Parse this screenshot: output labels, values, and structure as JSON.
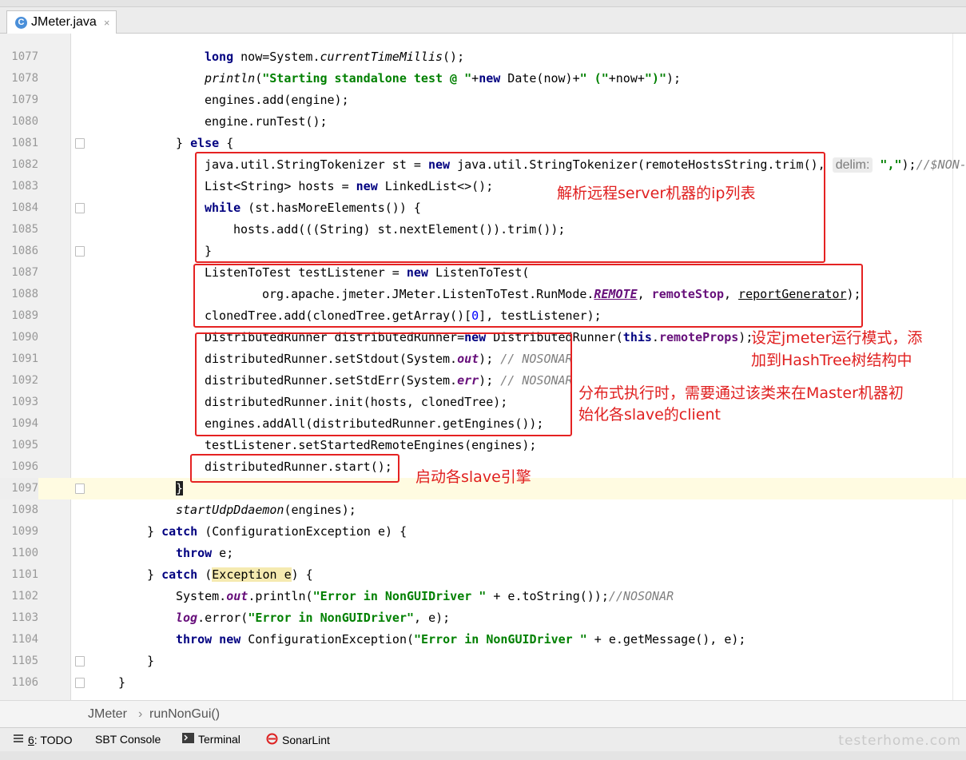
{
  "tab": {
    "label": "JMeter.java",
    "close": "×"
  },
  "gutter": {
    "lines": [
      "1077",
      "1078",
      "1079",
      "1080",
      "1081",
      "1082",
      "1083",
      "1084",
      "1085",
      "1086",
      "1087",
      "1088",
      "1089",
      "1090",
      "1091",
      "1092",
      "1093",
      "1094",
      "1095",
      "1096",
      "1097",
      "1098",
      "1099",
      "1100",
      "1101",
      "1102",
      "1103",
      "1104",
      "1105",
      "1106"
    ]
  },
  "hints": {
    "delim": "delim:"
  },
  "annotations": {
    "parse_hosts": "解析远程server机器的ip列表",
    "run_mode_1": "设定jmeter运行模式，添",
    "run_mode_2": "加到HashTree树结构中",
    "distributed_1": "分布式执行时，需要通过该类来在Master机器初",
    "distributed_2": "始化各slave的client",
    "start": "启动各slave引擎"
  },
  "breadcrumb": {
    "class_name": "JMeter",
    "separator": "›",
    "method": "runNonGui()"
  },
  "toolwindows": [
    {
      "key": "6",
      "label": ": TODO"
    },
    {
      "label": "SBT Console"
    },
    {
      "label": "Terminal"
    },
    {
      "label": "SonarLint"
    }
  ],
  "watermark": "testerhome.com",
  "colors": {
    "annotation": "#e02020",
    "keyword": "#000080",
    "string": "#008000",
    "field": "#660e7a",
    "current_line": "#fffbe1"
  }
}
